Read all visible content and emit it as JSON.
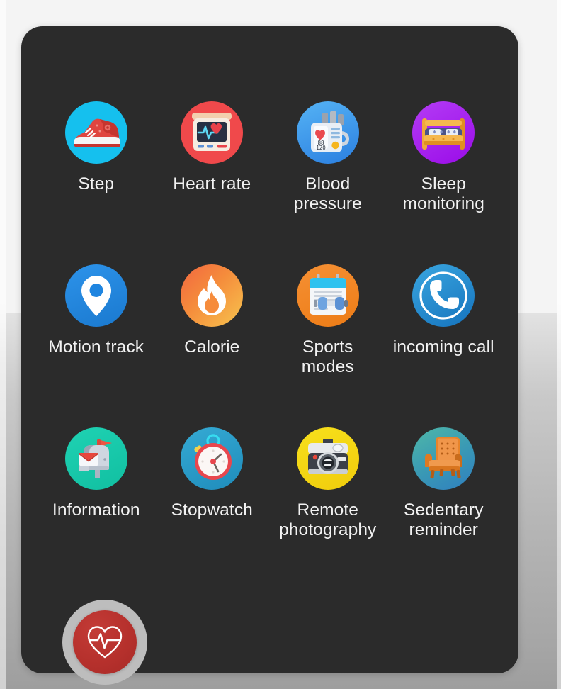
{
  "screen": {
    "title": "Smart band feature menu",
    "panel_color": "#2b2b2b",
    "label_color": "#f2f2f2",
    "background_top_color": "#f4f4f4",
    "background_bottom_color": "#a6a6a6"
  },
  "badge": {
    "name": "heart-pulse-badge",
    "icon": "heart-pulse-icon",
    "color": "#b5302c"
  },
  "menu": {
    "items": [
      {
        "label": "Step",
        "icon": "sneaker-icon",
        "bg": "#15c0ee"
      },
      {
        "label": "Heart rate",
        "icon": "heart-monitor-icon",
        "bg": "#f0494b"
      },
      {
        "label": "Blood pressure",
        "icon": "blood-pressure-icon",
        "bg": "#3b9ef0"
      },
      {
        "label": "Sleep monitoring",
        "icon": "bed-icon",
        "bg": "#a41ff0"
      },
      {
        "label": "Motion track",
        "icon": "map-pin-icon",
        "bg": "#1f85e0"
      },
      {
        "label": "Calorie",
        "icon": "flame-icon",
        "bg": "#f4a23c"
      },
      {
        "label": "Sports modes",
        "icon": "calendar-dumbbell-icon",
        "bg": "#f18522"
      },
      {
        "label": "incoming call",
        "icon": "phone-call-icon",
        "bg": "#1f8fd6"
      },
      {
        "label": "Information",
        "icon": "mailbox-icon",
        "bg": "#17c8ab"
      },
      {
        "label": "Stopwatch",
        "icon": "stopwatch-icon",
        "bg": "#2a9ec9"
      },
      {
        "label": "Remote photography",
        "icon": "camera-icon",
        "bg": "#f2d718"
      },
      {
        "label": "Sedentary reminder",
        "icon": "armchair-icon",
        "bg": "#3a9aa8"
      }
    ],
    "blood_pressure_display": {
      "diastolic": "88",
      "systolic": "120"
    }
  }
}
